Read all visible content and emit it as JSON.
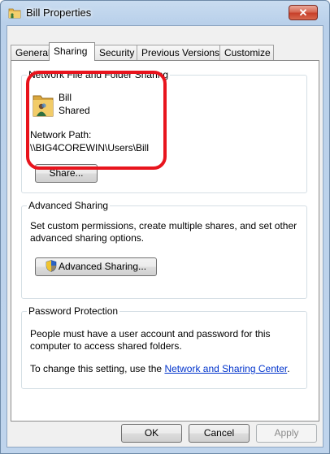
{
  "window": {
    "title": "Bill Properties",
    "close_label": "✕"
  },
  "tabs": [
    {
      "label": "General"
    },
    {
      "label": "Sharing",
      "active": true
    },
    {
      "label": "Security"
    },
    {
      "label": "Previous Versions"
    },
    {
      "label": "Customize"
    }
  ],
  "network_sharing": {
    "legend": "Network File and Folder Sharing",
    "folder_name": "Bill",
    "status": "Shared",
    "path_label": "Network Path:",
    "path_value": "\\\\BIG4COREWIN\\Users\\Bill",
    "share_button": "Share..."
  },
  "advanced_sharing": {
    "legend": "Advanced Sharing",
    "description_line1": "Set custom permissions, create multiple shares, and set other",
    "description_line2": "advanced sharing options.",
    "button": "Advanced Sharing..."
  },
  "password_protection": {
    "legend": "Password Protection",
    "description_line1": "People must have a user account and password for this",
    "description_line2": "computer to access shared folders.",
    "change_prefix": "To change this setting, use the ",
    "change_link": "Network and Sharing Center",
    "change_suffix": "."
  },
  "footer": {
    "ok": "OK",
    "cancel": "Cancel",
    "apply": "Apply"
  },
  "colors": {
    "highlight": "#e8141d",
    "link": "#0033cc"
  }
}
